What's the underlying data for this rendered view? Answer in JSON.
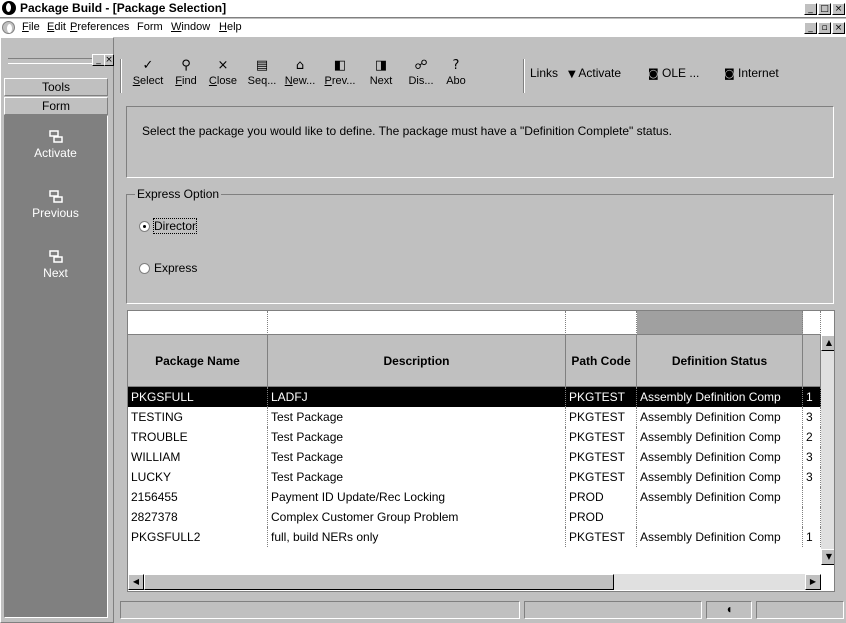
{
  "window": {
    "title": "Package Build - [Package Selection]"
  },
  "menu": [
    {
      "label": "File",
      "ul": "F",
      "rest": "ile"
    },
    {
      "label": "Edit",
      "ul": "E",
      "rest": "dit"
    },
    {
      "label": "Preferences",
      "ul": "P",
      "rest": "references"
    },
    {
      "label": "Form",
      "ul": "",
      "rest": "Form"
    },
    {
      "label": "Window",
      "ul": "W",
      "rest": "indow"
    },
    {
      "label": "Help",
      "ul": "H",
      "rest": "elp"
    }
  ],
  "sidebar": {
    "tools_label": "Tools",
    "form_label": "Form",
    "actions": [
      "Activate",
      "Previous",
      "Next"
    ]
  },
  "toolbar": {
    "buttons": [
      {
        "label": "Select",
        "u": "S",
        "rest": "elect",
        "glyph": "✓"
      },
      {
        "label": "Find",
        "u": "F",
        "rest": "ind",
        "glyph": "⚲"
      },
      {
        "label": "Close",
        "u": "C",
        "rest": "lose",
        "glyph": "×"
      },
      {
        "label": "Seq...",
        "u": "",
        "rest": "Seq...",
        "glyph": "▤"
      },
      {
        "label": "New...",
        "u": "N",
        "rest": "ew...",
        "glyph": "⌂"
      },
      {
        "label": "Prev...",
        "u": "P",
        "rest": "rev...",
        "glyph": "◧"
      },
      {
        "label": "Next",
        "u": "",
        "rest": "Next",
        "glyph": "◨"
      },
      {
        "label": "Dis...",
        "u": "",
        "rest": "Dis...",
        "glyph": "☍"
      },
      {
        "label": "Abo",
        "u": "",
        "rest": "Abo",
        "glyph": "?"
      }
    ],
    "links_label": "Links",
    "activate_label": "Activate",
    "ole_label": "OLE ...",
    "internet_label": "Internet"
  },
  "instructions": "Select the package you would like to define.  The package must have a \"Definition Complete\" status.",
  "express_option": {
    "legend": "Express Option",
    "options": [
      "Director",
      "Express"
    ],
    "selected": "Director"
  },
  "grid": {
    "columns": [
      "Package Name",
      "Description",
      "Path Code",
      "Definition Status"
    ],
    "rows": [
      {
        "name": "PKGSFULL",
        "desc": "LADFJ",
        "path": "PKGTEST",
        "status": "Assembly Definition Comp",
        "extra": "1"
      },
      {
        "name": "TESTING",
        "desc": "Test Package",
        "path": "PKGTEST",
        "status": "Assembly Definition Comp",
        "extra": "3"
      },
      {
        "name": "TROUBLE",
        "desc": "Test Package",
        "path": "PKGTEST",
        "status": "Assembly Definition Comp",
        "extra": "2"
      },
      {
        "name": "WILLIAM",
        "desc": "Test Package",
        "path": "PKGTEST",
        "status": "Assembly Definition Comp",
        "extra": "3"
      },
      {
        "name": "LUCKY",
        "desc": "Test Package",
        "path": "PKGTEST",
        "status": "Assembly Definition Comp",
        "extra": "3"
      },
      {
        "name": "2156455",
        "desc": "Payment ID Update/Rec Locking",
        "path": "PROD",
        "status": "Assembly Definition Comp",
        "extra": ""
      },
      {
        "name": "2827378",
        "desc": "Complex Customer Group Problem",
        "path": "PROD",
        "status": "",
        "extra": ""
      },
      {
        "name": "PKGSFULL2",
        "desc": "full, build NERs only",
        "path": "PKGTEST",
        "status": "Assembly Definition Comp",
        "extra": "1"
      }
    ],
    "selected_row": 0
  }
}
